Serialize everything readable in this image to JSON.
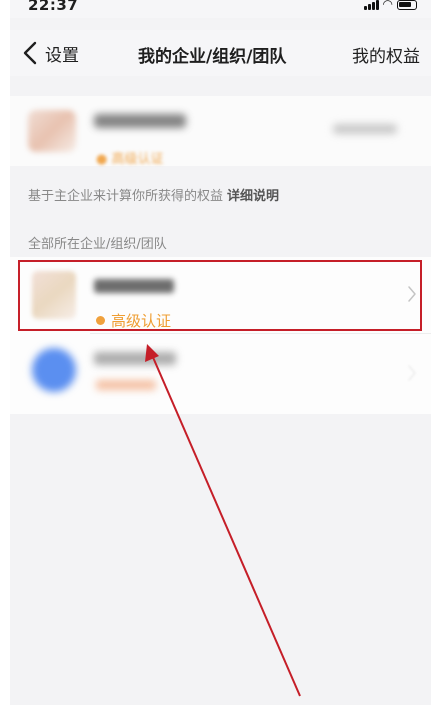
{
  "status_bar": {
    "time": "22:37"
  },
  "nav": {
    "back_label": "设置",
    "title": "我的企业/组织/团队",
    "right_label": "我的权益"
  },
  "current_company": {
    "badge": "● 高级认证"
  },
  "benefit_hint": {
    "text": "基于主企业来计算你所获得的权益",
    "detail_link": "详细说明"
  },
  "section_title": "全部所在企业/组织/团队",
  "org_list": [
    {
      "badge": "高级认证",
      "badge_color": "#ef9e33"
    },
    {}
  ],
  "annotation": {
    "box_color": "#c51e28",
    "arrow_color": "#c51e28"
  }
}
